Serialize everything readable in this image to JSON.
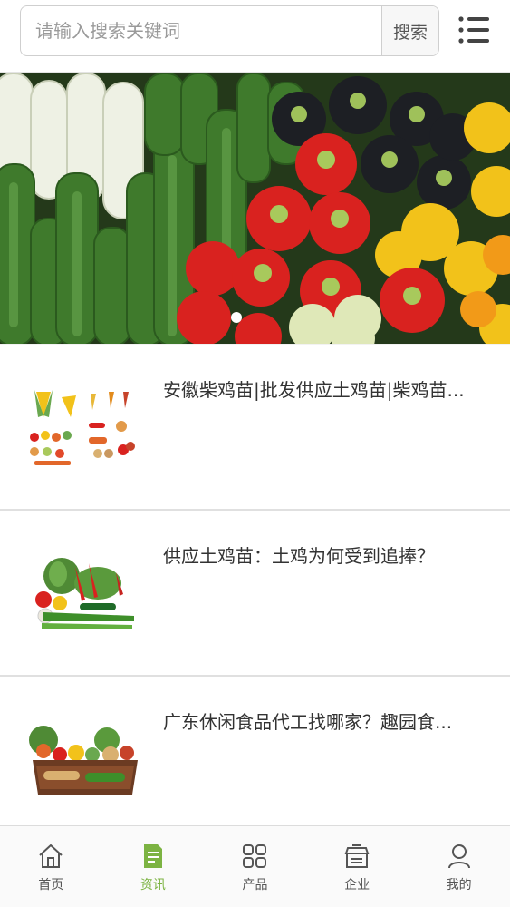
{
  "search": {
    "placeholder": "请输入搜索关键词",
    "button_label": "搜索"
  },
  "menu": {
    "icon": "list-menu-icon"
  },
  "banner": {
    "slide_indicator": "dot",
    "subject": "vegetables"
  },
  "news": [
    {
      "title": "安徽柴鸡苗|批发供应土鸡苗|柴鸡苗..."
    },
    {
      "title": "供应土鸡苗：土鸡为何受到追捧？"
    },
    {
      "title": "广东休闲食品代工找哪家？趣园食..."
    }
  ],
  "tabbar": {
    "active": "资讯",
    "accent_color": "#7cb342",
    "items": [
      {
        "label": "首页",
        "icon": "home-icon"
      },
      {
        "label": "资讯",
        "icon": "news-doc-icon"
      },
      {
        "label": "产品",
        "icon": "grid-icon"
      },
      {
        "label": "企业",
        "icon": "store-icon"
      },
      {
        "label": "我的",
        "icon": "user-icon"
      }
    ]
  }
}
